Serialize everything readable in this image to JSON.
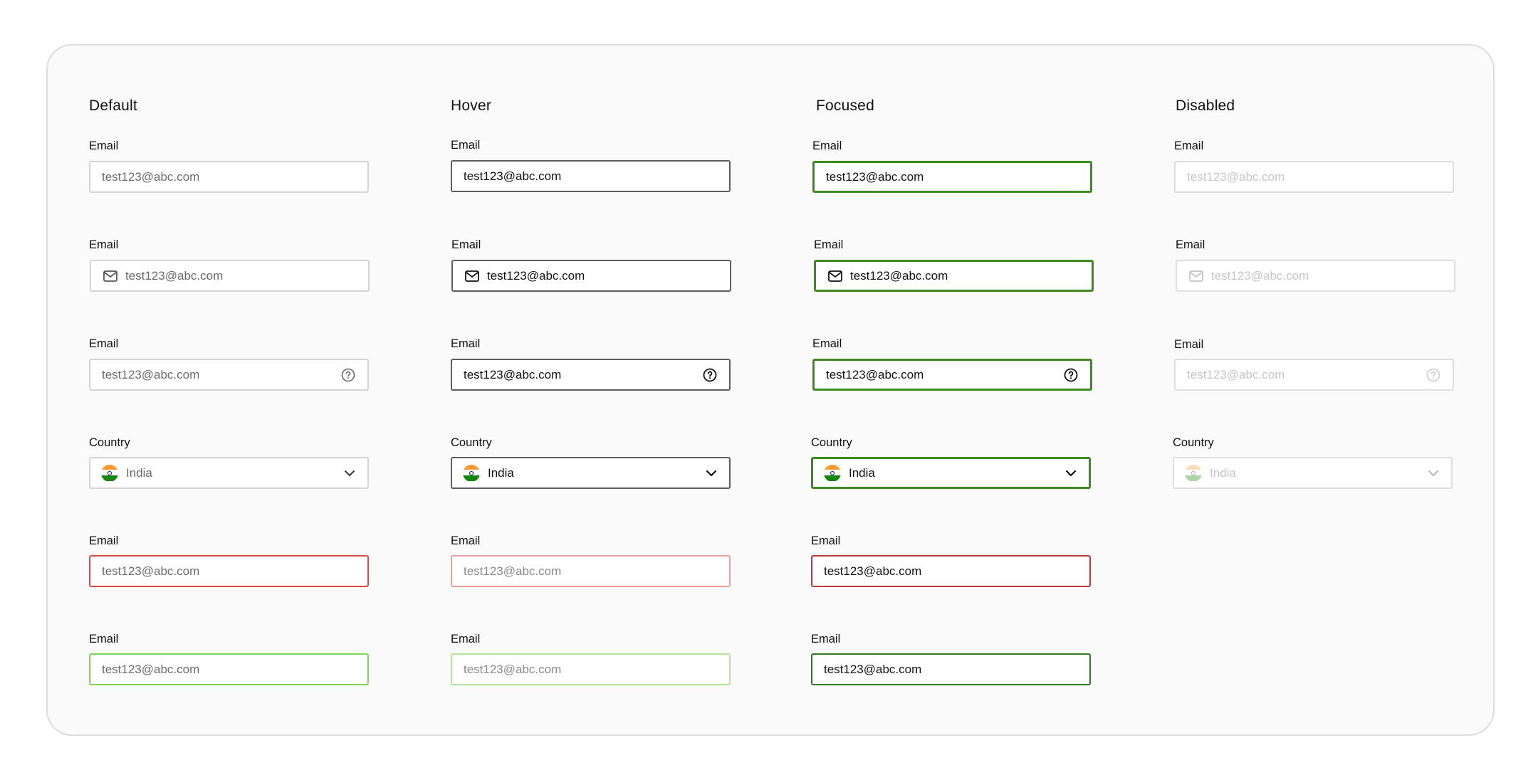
{
  "columns": {
    "default": "Default",
    "hover": "Hover",
    "focused": "Focused",
    "disabled": "Disabled"
  },
  "labels": {
    "email": "Email",
    "country": "Country"
  },
  "values": {
    "email": "test123@abc.com",
    "country": "India"
  },
  "colors": {
    "hover_border": "#5e5e5e",
    "focus_border": "#3f8a1f",
    "error_border": "#d94a4a",
    "success_border": "#7cd45c",
    "disabled_text": "#c6c6c6"
  },
  "icons": {
    "leading_email": "mail-icon",
    "trailing_help": "help-circle-icon",
    "country_flag": "india-flag-icon",
    "dropdown": "chevron-down-icon"
  }
}
